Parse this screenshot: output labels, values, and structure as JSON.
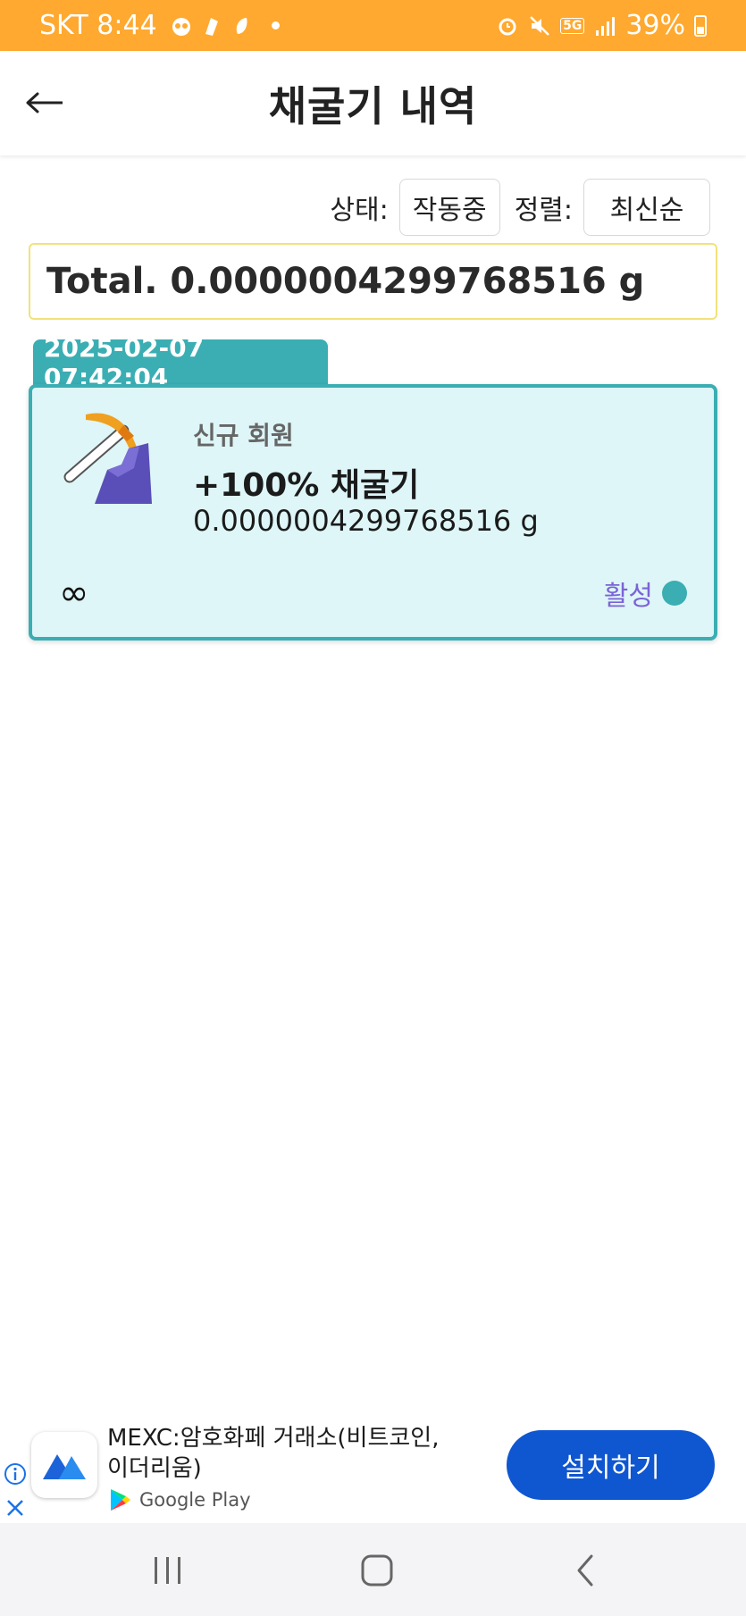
{
  "status_bar": {
    "carrier_time": "SKT 8:44",
    "battery": "39%",
    "network": "5G"
  },
  "header": {
    "back_icon": "back-arrow-icon",
    "title": "채굴기 내역"
  },
  "filters": {
    "status_label": "상태:",
    "status_value": "작동중",
    "sort_label": "정렬:",
    "sort_value": "최신순"
  },
  "total": {
    "text": "Total. 0.0000004299768516 g"
  },
  "miners": [
    {
      "date": "2025-02-07 07:42:04",
      "icon": "pickaxe-icon",
      "subtitle": "신규 회원",
      "title": "+100% 채굴기",
      "amount": "0.0000004299768516 g",
      "duration": "∞",
      "status": "활성",
      "accent_color": "#3aaeb3"
    }
  ],
  "ad": {
    "title": "MEXC:암호화페 거래소(비트코인, 이더리움)",
    "store": "Google Play",
    "install_label": "설치하기",
    "button_color": "#0f56d1"
  },
  "colors": {
    "status_bar": "#ffa930",
    "card_bg": "#def6f7",
    "card_border": "#3aaeb3",
    "active_text": "#7b63d8"
  }
}
